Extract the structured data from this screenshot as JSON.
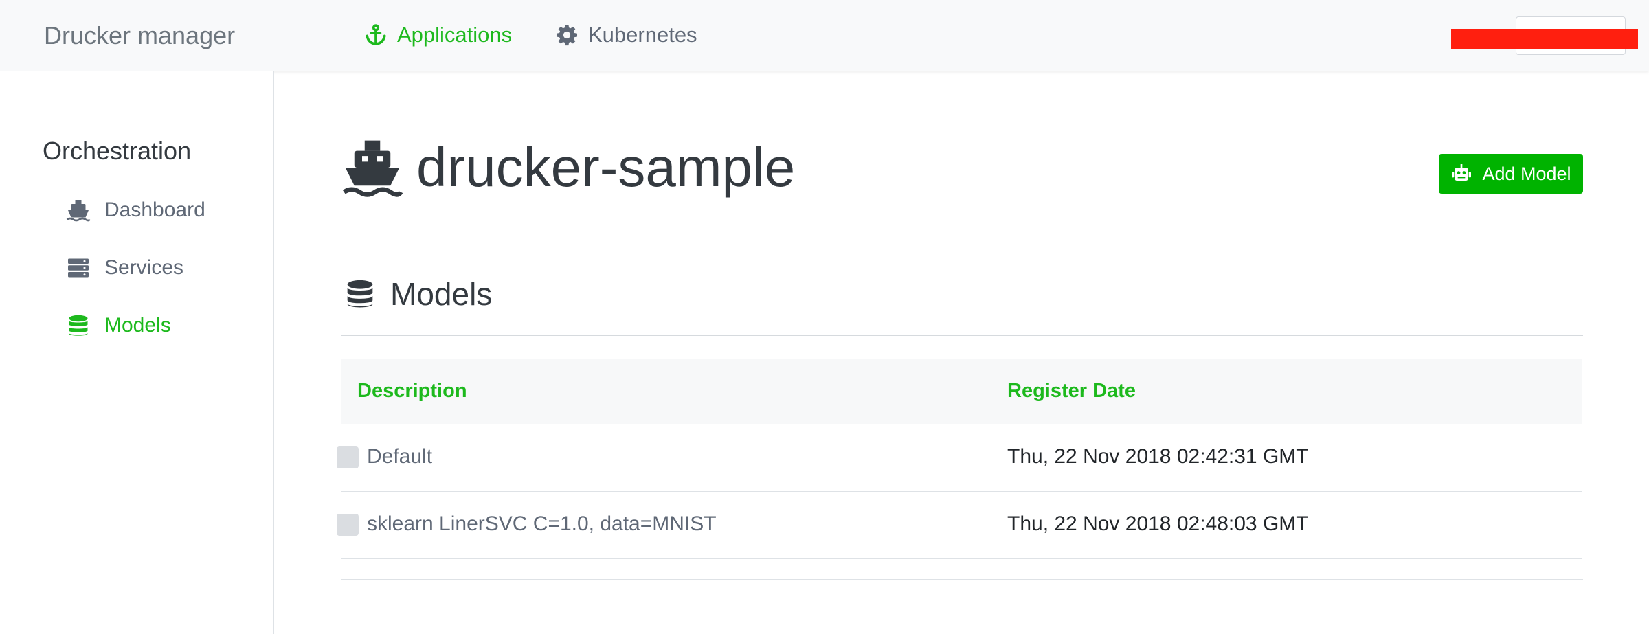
{
  "navbar": {
    "brand": "Drucker manager",
    "links": [
      {
        "label": "Applications",
        "icon": "anchor-icon",
        "active": true
      },
      {
        "label": "Kubernetes",
        "icon": "gear-icon",
        "active": false
      }
    ]
  },
  "sidebar": {
    "title": "Orchestration",
    "items": [
      {
        "label": "Dashboard",
        "icon": "ship-icon",
        "active": false
      },
      {
        "label": "Services",
        "icon": "server-icon",
        "active": false
      },
      {
        "label": "Models",
        "icon": "database-icon",
        "active": true
      }
    ]
  },
  "main": {
    "app_name": "drucker-sample",
    "add_button_label": "Add Model",
    "section_title": "Models",
    "table": {
      "columns": [
        "Description",
        "Register Date"
      ],
      "rows": [
        {
          "description": "Default",
          "register_date": "Thu, 22 Nov 2018 02:42:31 GMT"
        },
        {
          "description": "sklearn LinerSVC C=1.0, data=MNIST",
          "register_date": "Thu, 22 Nov 2018 02:48:03 GMT"
        }
      ]
    }
  },
  "colors": {
    "accent": "#1db91d",
    "button": "#00b300",
    "redaction": "#ff1f0f"
  }
}
